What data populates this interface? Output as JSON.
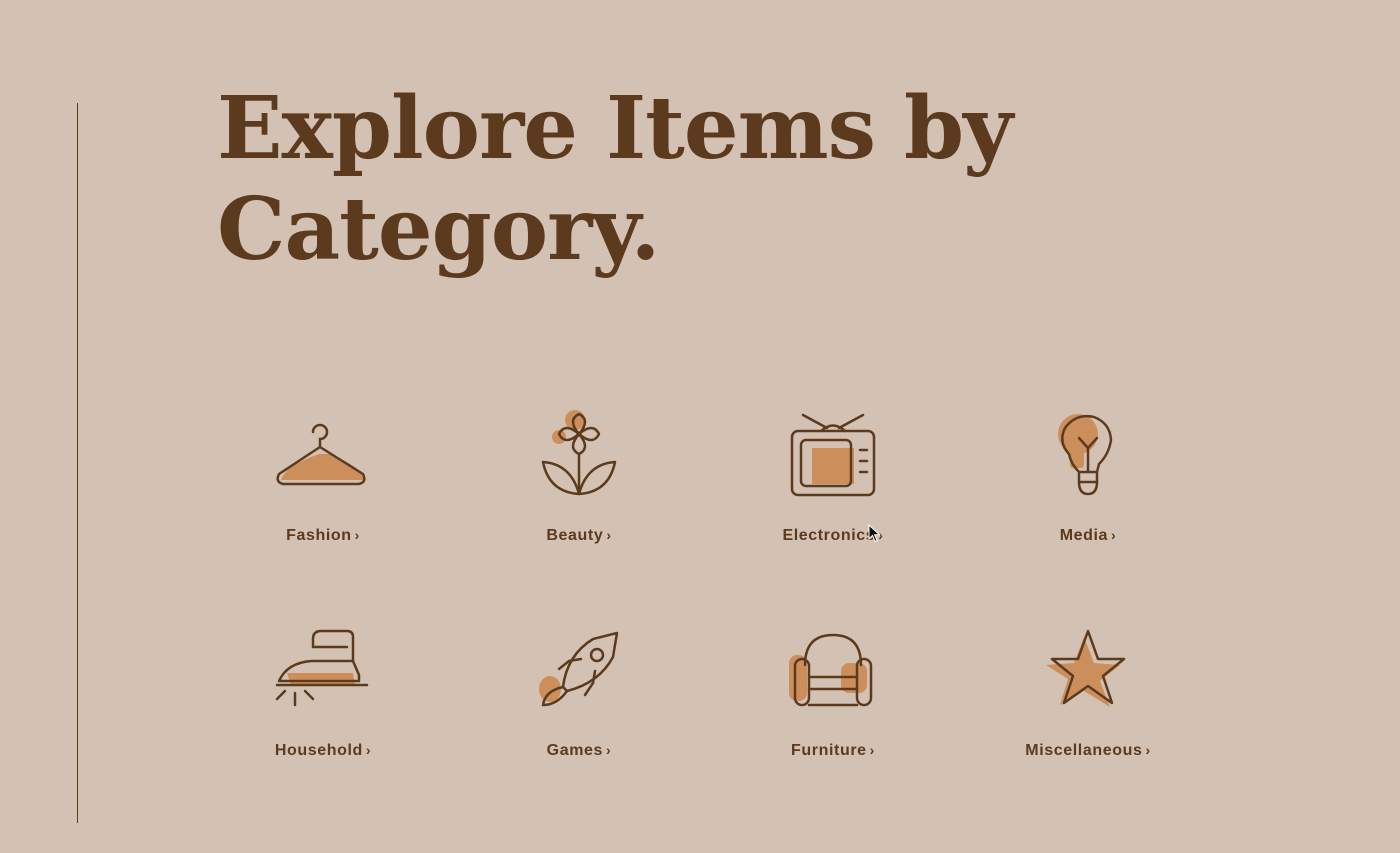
{
  "title": {
    "line1": "Explore Items by",
    "line2": "Category."
  },
  "categories": [
    {
      "label": "Fashion",
      "icon": "hanger-icon"
    },
    {
      "label": "Beauty",
      "icon": "flower-icon"
    },
    {
      "label": "Electronics",
      "icon": "tv-icon"
    },
    {
      "label": "Media",
      "icon": "lightbulb-icon"
    },
    {
      "label": "Household",
      "icon": "iron-icon"
    },
    {
      "label": "Games",
      "icon": "rocket-icon"
    },
    {
      "label": "Furniture",
      "icon": "armchair-icon"
    },
    {
      "label": "Miscellaneous",
      "icon": "star-icon"
    }
  ],
  "colors": {
    "background": "#d3c2b4",
    "text": "#5b3a1e",
    "accent": "#cc8f5c"
  }
}
